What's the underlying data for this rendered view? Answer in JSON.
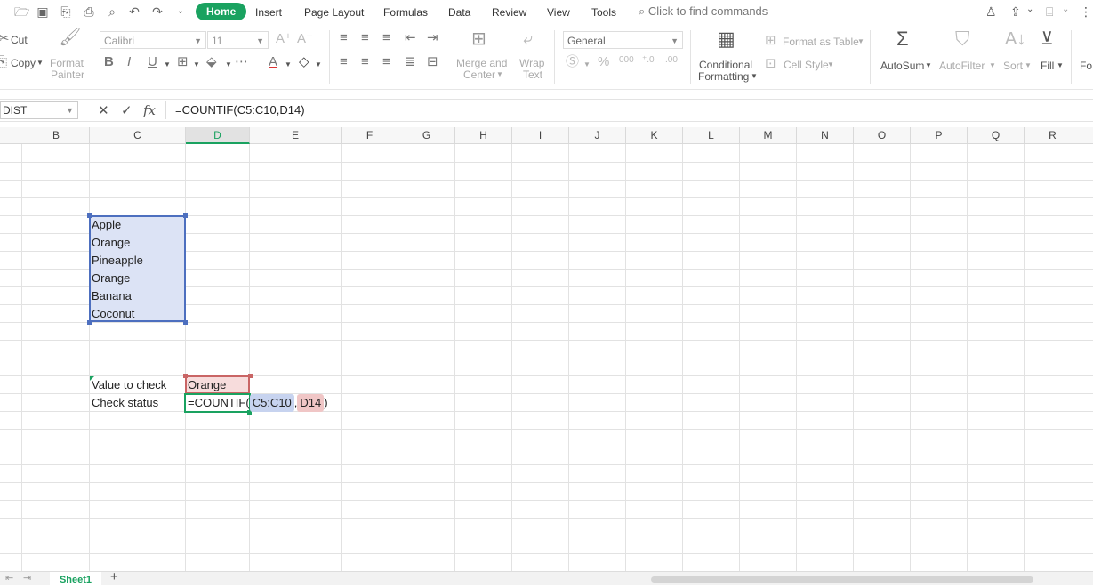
{
  "menubar": {
    "tabs": [
      "Home",
      "Insert",
      "Page Layout",
      "Formulas",
      "Data",
      "Review",
      "View",
      "Tools"
    ],
    "active_tab": "Home",
    "search_placeholder": "Click to find commands"
  },
  "ribbon": {
    "cut": "Cut",
    "copy": "Copy",
    "format_painter_1": "Format",
    "format_painter_2": "Painter",
    "font_name": "Calibri",
    "font_size": "11",
    "merge_1": "Merge and",
    "merge_2": "Center",
    "wrap_1": "Wrap",
    "wrap_2": "Text",
    "number_format": "General",
    "conditional_1": "Conditional",
    "conditional_2": "Formatting",
    "format_as_table": "Format as Table",
    "cell_style": "Cell Style",
    "autosum": "AutoSum",
    "autofilter": "AutoFilter",
    "sort": "Sort",
    "fill": "Fill",
    "cut_off": "Fo"
  },
  "formula_bar": {
    "name_box": "DIST",
    "formula": "=COUNTIF(C5:C10,D14)"
  },
  "columns": [
    "B",
    "C",
    "D",
    "E",
    "F",
    "G",
    "H",
    "I",
    "J",
    "K",
    "L",
    "M",
    "N",
    "O",
    "P",
    "Q",
    "R"
  ],
  "selected_column": "D",
  "cells": {
    "list": [
      "Apple",
      "Orange",
      "Pineapple",
      "Orange",
      "Banana",
      "Coconut"
    ],
    "value_label": "Value to check",
    "value": "Orange",
    "status_label": "Check status",
    "edit_prefix": "=COUNTIF(",
    "edit_range": "C5:C10",
    "edit_comma": ",",
    "edit_ref": "D14",
    "edit_close": ")"
  },
  "sheet": {
    "tab": "Sheet1"
  }
}
